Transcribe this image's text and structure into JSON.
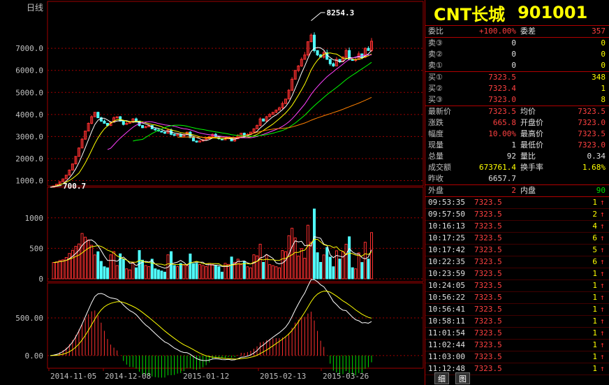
{
  "chart": {
    "period_label": "日线",
    "price_ticks": [
      "7000.0",
      "6000.0",
      "5000.0",
      "4000.0",
      "3000.0",
      "2000.0",
      "1000.0"
    ],
    "price_tick_values": [
      7000,
      6000,
      5000,
      4000,
      3000,
      2000,
      1000
    ],
    "vol_ticks": [
      "1000",
      "500",
      "0"
    ],
    "vol_tick_values": [
      1000,
      500,
      0
    ],
    "macd_ticks": [
      "500.00",
      "0.00"
    ],
    "macd_tick_values": [
      500,
      0
    ],
    "high_label": "8254.3",
    "low_label": "700.7",
    "dates": [
      "2014-11-05",
      "2014-12-08",
      "2015-01-12",
      "2015-02-13",
      "2015-03-26"
    ],
    "colors": {
      "up": "#ff3030",
      "down": "#50ffff",
      "ma5": "#ffffff",
      "ma10": "#ffff00",
      "ma20": "#ff40ff",
      "ma30": "#00ff00",
      "ma60": "#ff8000",
      "grid": "#a00000"
    }
  },
  "chart_data": {
    "type": "candlestick",
    "price_range": [
      700,
      8400
    ],
    "series": [
      {
        "name": "price_close",
        "values": [
          700,
          760,
          840,
          950,
          1080,
          1250,
          1480,
          1760,
          2100,
          2480,
          2880,
          3250,
          3600,
          3900,
          4100,
          3850,
          3700,
          3600,
          3500,
          3650,
          3850,
          3900,
          3700,
          3550,
          3600,
          3650,
          3800,
          3700,
          3500,
          3400,
          3450,
          3500,
          3350,
          3300,
          3250,
          3200,
          3150,
          3300,
          3100,
          3050,
          3100,
          3000,
          3100,
          3200,
          2950,
          2800,
          2750,
          2800,
          2850,
          2900,
          3000,
          3100,
          3000,
          2900,
          2850,
          2900,
          2950,
          2800,
          2900,
          3050,
          3150,
          3000,
          3100,
          3200,
          3350,
          3500,
          3800,
          3700,
          3900,
          4000,
          4100,
          4200,
          4300,
          4500,
          4700,
          5100,
          5600,
          6000,
          6200,
          6500,
          6700,
          7300,
          7600,
          6900,
          6700,
          6600,
          6800,
          6500,
          6300,
          6200,
          6500,
          6400,
          6600,
          6900,
          6500,
          6450,
          6500,
          6750,
          6600,
          7000,
          6900,
          7323.5
        ]
      }
    ],
    "volume_range": [
      0,
      1250
    ],
    "macd_range": [
      -150,
      900
    ]
  },
  "header": {
    "name": "CNT长城",
    "code": "901001"
  },
  "quote": {
    "weibi_label": "委比",
    "weibi": "+100.00%",
    "weicha_label": "委差",
    "weicha": "357",
    "sell": [
      {
        "label": "卖③",
        "price": "0",
        "vol": "0"
      },
      {
        "label": "卖②",
        "price": "0",
        "vol": "0"
      },
      {
        "label": "卖①",
        "price": "0",
        "vol": "0"
      }
    ],
    "buy": [
      {
        "label": "买①",
        "price": "7323.5",
        "vol": "348"
      },
      {
        "label": "买②",
        "price": "7323.4",
        "vol": "1"
      },
      {
        "label": "买③",
        "price": "7323.0",
        "vol": "8"
      }
    ],
    "stats": [
      {
        "l1": "最新价",
        "v1": "7323.5",
        "c1": "red",
        "l2": "均价",
        "v2": "7323.5",
        "c2": "red"
      },
      {
        "l1": "涨跌",
        "v1": "665.8",
        "c1": "red",
        "l2": "开盘价",
        "v2": "7323.0",
        "c2": "red"
      },
      {
        "l1": "幅度",
        "v1": "10.00%",
        "c1": "red",
        "l2": "最高价",
        "v2": "7323.5",
        "c2": "red"
      },
      {
        "l1": "现量",
        "v1": "1",
        "c1": "white",
        "l2": "最低价",
        "v2": "7323.0",
        "c2": "red"
      },
      {
        "l1": "总量",
        "v1": "92",
        "c1": "white",
        "l2": "量比",
        "v2": "0.34",
        "c2": "white"
      },
      {
        "l1": "成交额",
        "v1": "673761.4",
        "c1": "yellow",
        "l2": "换手率",
        "v2": "1.68%",
        "c2": "yellow"
      },
      {
        "l1": "昨收",
        "v1": "6657.7",
        "c1": "white",
        "l2": "",
        "v2": "",
        "c2": "white"
      }
    ],
    "waipan_label": "外盘",
    "waipan": "2",
    "neipan_label": "内盘",
    "neipan": "90"
  },
  "ticks": [
    {
      "time": "09:53:35",
      "price": "7323.5",
      "vol": "1"
    },
    {
      "time": "09:57:50",
      "price": "7323.5",
      "vol": "2"
    },
    {
      "time": "10:16:13",
      "price": "7323.5",
      "vol": "4"
    },
    {
      "time": "10:17:25",
      "price": "7323.5",
      "vol": "6"
    },
    {
      "time": "10:17:42",
      "price": "7323.5",
      "vol": "5"
    },
    {
      "time": "10:22:35",
      "price": "7323.5",
      "vol": "6"
    },
    {
      "time": "10:23:59",
      "price": "7323.5",
      "vol": "1"
    },
    {
      "time": "10:24:05",
      "price": "7323.5",
      "vol": "1"
    },
    {
      "time": "10:56:22",
      "price": "7323.5",
      "vol": "1"
    },
    {
      "time": "10:56:41",
      "price": "7323.5",
      "vol": "1"
    },
    {
      "time": "10:58:11",
      "price": "7323.5",
      "vol": "1"
    },
    {
      "time": "11:01:54",
      "price": "7323.5",
      "vol": "1"
    },
    {
      "time": "11:02:44",
      "price": "7323.5",
      "vol": "1"
    },
    {
      "time": "11:03:00",
      "price": "7323.5",
      "vol": "1"
    },
    {
      "time": "11:12:48",
      "price": "7323.5",
      "vol": "1"
    }
  ],
  "tick_arrow": "↑",
  "tabs": [
    "细",
    "图"
  ]
}
